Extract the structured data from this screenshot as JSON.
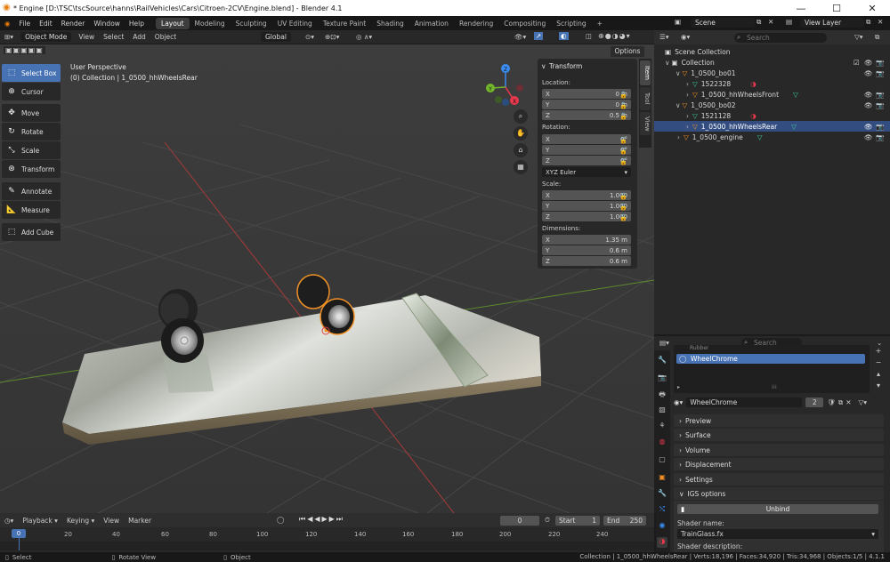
{
  "window": {
    "title": "* Engine [D:\\TSC\\tscSource\\hanns\\RailVehicles\\Cars\\Citroen-2CV\\Engine.blend] - Blender 4.1"
  },
  "menu": [
    "File",
    "Edit",
    "Render",
    "Window",
    "Help"
  ],
  "workspaces": [
    "Layout",
    "Modeling",
    "Sculpting",
    "UV Editing",
    "Texture Paint",
    "Shading",
    "Animation",
    "Rendering",
    "Compositing",
    "Scripting"
  ],
  "workspace_plus": "+",
  "scene": "Scene",
  "view_layer": "View Layer",
  "viewport_header": {
    "mode": "Object Mode",
    "items": [
      "View",
      "Select",
      "Add",
      "Object"
    ],
    "orientation": "Global",
    "options": "Options"
  },
  "viewport": {
    "perspective": "User Perspective",
    "collection_info": "(0) Collection | 1_0500_hhWheelsRear"
  },
  "tools": [
    "Select Box",
    "Cursor",
    "Move",
    "Rotate",
    "Scale",
    "Transform",
    "Annotate",
    "Measure",
    "Add Cube"
  ],
  "gizmo": {
    "x": "X",
    "y": "Y",
    "z": "Z"
  },
  "transform": {
    "title": "Transform",
    "location_label": "Location:",
    "location": [
      {
        "axis": "X",
        "value": "0 m"
      },
      {
        "axis": "Y",
        "value": "0 m"
      },
      {
        "axis": "Z",
        "value": "0.5 m"
      }
    ],
    "rotation_label": "Rotation:",
    "rotation": [
      {
        "axis": "X",
        "value": "0°"
      },
      {
        "axis": "Y",
        "value": "0°"
      },
      {
        "axis": "Z",
        "value": "0°"
      }
    ],
    "rotation_mode": "XYZ Euler",
    "scale_label": "Scale:",
    "scale": [
      {
        "axis": "X",
        "value": "1.000"
      },
      {
        "axis": "Y",
        "value": "1.000"
      },
      {
        "axis": "Z",
        "value": "1.000"
      }
    ],
    "dimensions_label": "Dimensions:",
    "dimensions": [
      {
        "axis": "X",
        "value": "1.35 m"
      },
      {
        "axis": "Y",
        "value": "0.6 m"
      },
      {
        "axis": "Z",
        "value": "0.6 m"
      }
    ]
  },
  "n_tabs": [
    "Item",
    "Tool",
    "View"
  ],
  "outliner": {
    "search_placeholder": "Search",
    "rows": [
      {
        "label": "Scene Collection"
      },
      {
        "label": "Collection"
      },
      {
        "label": "1_0500_bo01"
      },
      {
        "label": "1522328"
      },
      {
        "label": "1_0500_hhWheelsFront"
      },
      {
        "label": "1_0500_bo02"
      },
      {
        "label": "1521128"
      },
      {
        "label": "1_0500_hhWheelsRear"
      },
      {
        "label": "1_0500_engine"
      }
    ]
  },
  "properties": {
    "search_placeholder": "Search",
    "slot_hidden": "Rubber",
    "slot_selected": "WheelChrome",
    "material_name": "WheelChrome",
    "users": "2",
    "panels": [
      "Preview",
      "Surface",
      "Volume",
      "Displacement",
      "Settings",
      "IGS options"
    ],
    "unbind": "Unbind",
    "shader_name_label": "Shader name:",
    "shader_name": "TrainGlass.fx",
    "shader_desc_label": "Shader description:"
  },
  "timeline": {
    "menu": [
      "Playback",
      "Keying",
      "View",
      "Marker"
    ],
    "current_frame": "0",
    "start_label": "Start",
    "start": "1",
    "end_label": "End",
    "end": "250",
    "ticks": [
      "0",
      "20",
      "40",
      "60",
      "80",
      "100",
      "120",
      "140",
      "160",
      "180",
      "200",
      "220",
      "240"
    ]
  },
  "status": {
    "select": "Select",
    "rotate": "Rotate View",
    "object": "Object",
    "stats": "Collection | 1_0500_hhWheelsRear | Verts:18,196 | Faces:34,920 | Tris:34,968 | Objects:1/5 | 4.1.1"
  },
  "colors": {
    "accent": "#4772b3",
    "selection_orange": "#f09024",
    "axis_x": "#e8384d",
    "axis_y": "#73b82c",
    "axis_z": "#3b8cf2"
  }
}
